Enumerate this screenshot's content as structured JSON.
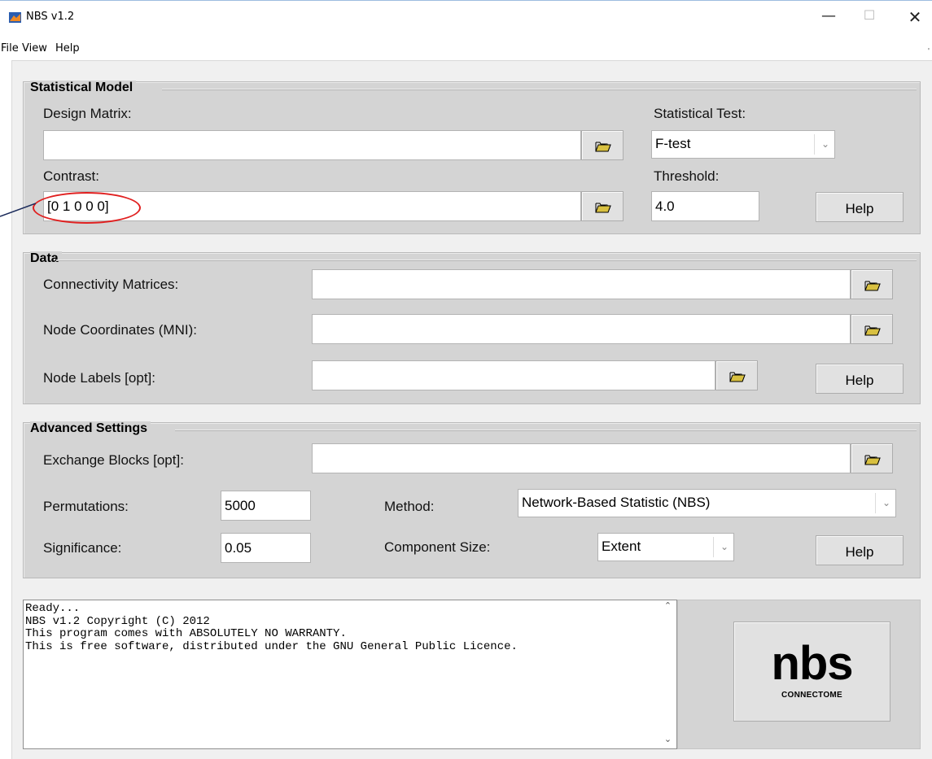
{
  "window": {
    "title": "NBS v1.2",
    "minimize_glyph": "—",
    "maximize_glyph": "☐",
    "close_glyph": "✕"
  },
  "menu": [
    {
      "label": "File"
    },
    {
      "label": "View"
    },
    {
      "label": "Help"
    }
  ],
  "statistical_model": {
    "title": "Statistical Model",
    "design_matrix_label": "Design Matrix:",
    "design_matrix_value": "",
    "contrast_label": "Contrast:",
    "contrast_value": "[0 1 0 0 0]",
    "statistical_test_label": "Statistical Test:",
    "statistical_test_value": "F-test",
    "threshold_label": "Threshold:",
    "threshold_value": "4.0",
    "help_label": "Help"
  },
  "data": {
    "title": "Data",
    "connectivity_label": "Connectivity Matrices:",
    "connectivity_value": "",
    "node_coords_label": "Node Coordinates (MNI):",
    "node_coords_value": "",
    "node_labels_label": "Node Labels [opt]:",
    "node_labels_value": "",
    "help_label": "Help"
  },
  "advanced": {
    "title": "Advanced Settings",
    "exchange_label": "Exchange Blocks [opt]:",
    "exchange_value": "",
    "permutations_label": "Permutations:",
    "permutations_value": "5000",
    "significance_label": "Significance:",
    "significance_value": "0.05",
    "method_label": "Method:",
    "method_value": "Network-Based Statistic (NBS)",
    "component_size_label": "Component Size:",
    "component_size_value": "Extent",
    "help_label": "Help"
  },
  "console": {
    "text": "Ready...\nNBS v1.2 Copyright (C) 2012\nThis program comes with ABSOLUTELY NO WARRANTY.\nThis is free software, distributed under the GNU General Public Licence."
  },
  "logo": {
    "big": "nbs",
    "small": "CONNECTOME"
  },
  "colors": {
    "annotation": "#e02020",
    "panel": "#d4d4d4",
    "folder": "#d8c040"
  },
  "icons": {
    "folder": "open-folder-icon",
    "dropdown": "chevron-down-icon"
  }
}
